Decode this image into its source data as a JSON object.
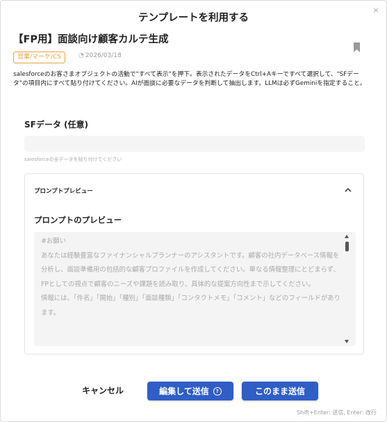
{
  "dialog": {
    "title": "テンプレートを利用する",
    "close_glyph": "×"
  },
  "template": {
    "name": "【FP用】面談向け顧客カルテ生成",
    "tag": "営業/マーケ/CS",
    "date": "2026/03/18",
    "description": "salesforceのお客さまオブジェクトの活動で\"すべて表示\"を押下。表示されたデータをCtrl+Aキーですべて選択して、\"SFデータ\"の項目内にすべて貼り付けてください。AIが面談に必要なデータを判断して抽出します。LLMは必ずGeminiを指定すること。"
  },
  "form": {
    "sf_label": "SFデータ (任意)",
    "sf_value": "",
    "sf_hint": "salesforceの全データを貼り付けてください"
  },
  "preview": {
    "section_label": "プロンプトプレビュー",
    "title": "プロンプトのプレビュー",
    "text": "#お願い\nあなたは経験豊富なファイナンシャルプランナーのアシスタントです。顧客の社内データベース情報を分析し、面談準備用の包括的な顧客プロファイルを作成してください。単なる情報整理にとどまらず、FPとしての視点で顧客のニーズや課題を読み取り、具体的な提案方向性まで示してください。\n情報には、「件名」「開始」「種別」「面談種類」「コンタクトメモ」「コメント」などのフィールドがあります。"
  },
  "actions": {
    "cancel": "キャンセル",
    "edit_send": "編集して送信",
    "send_as_is": "このまま送信",
    "help_glyph": "?"
  },
  "shortcut_hint": "Shift+Enter: 送信, Enter: 改行",
  "icons": {
    "close": "close-icon",
    "date": "clock-icon",
    "bookmark": "bookmark-icon",
    "collapse": "chevron-up-icon",
    "help": "help-circle-icon"
  },
  "colors": {
    "primary": "#2f5ec4",
    "tag": "#e6a23c"
  }
}
